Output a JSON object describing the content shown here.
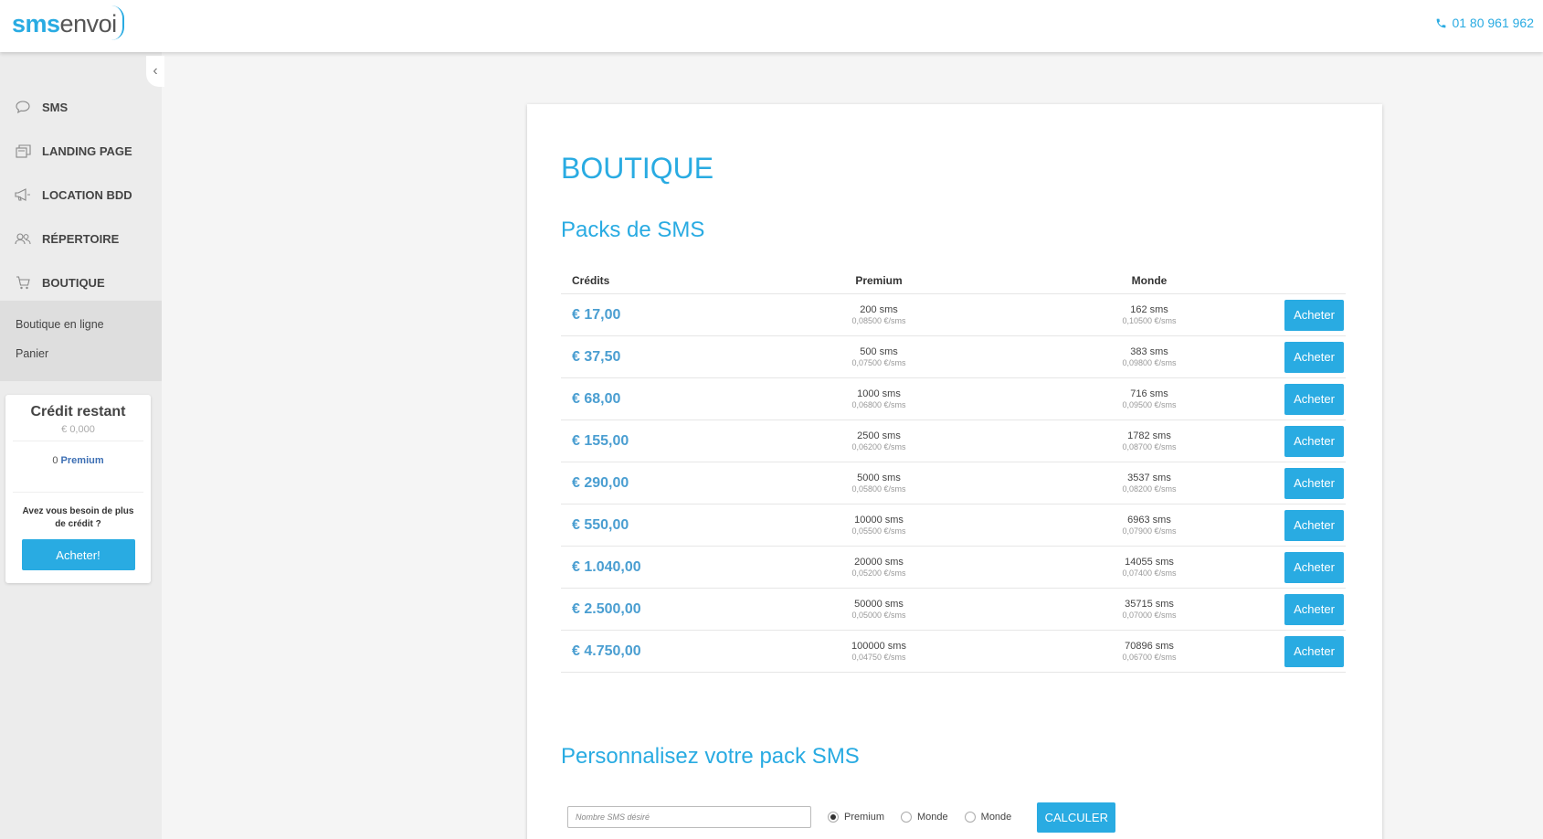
{
  "header": {
    "logo_part1": "sms",
    "logo_part2": "envoi",
    "phone": "01 80 961 962"
  },
  "sidebar": {
    "items": [
      {
        "label": "SMS",
        "icon": "chat-bubble-icon"
      },
      {
        "label": "LANDING PAGE",
        "icon": "layers-icon"
      },
      {
        "label": "LOCATION BDD",
        "icon": "megaphone-icon"
      },
      {
        "label": "RÉPERTOIRE",
        "icon": "contacts-icon"
      },
      {
        "label": "BOUTIQUE",
        "icon": "cart-icon"
      }
    ],
    "sub_items": [
      {
        "label": "Boutique en ligne"
      },
      {
        "label": "Panier"
      }
    ],
    "credit": {
      "title": "Crédit restant",
      "amount": "€ 0,000",
      "premium_count": "0",
      "premium_label": "Premium",
      "need_more": "Avez vous besoin de plus de crédit ?",
      "buy_label": "Acheter!"
    }
  },
  "main": {
    "title": "BOUTIQUE",
    "packs_title": "Packs de SMS",
    "columns": {
      "credits": "Crédits",
      "premium": "Premium",
      "monde": "Monde"
    },
    "rows": [
      {
        "price": "€ 17,00",
        "premium_qty": "200 sms",
        "premium_rate": "0,08500 €/sms",
        "monde_qty": "162 sms",
        "monde_rate": "0,10500 €/sms",
        "button": "Acheter"
      },
      {
        "price": "€ 37,50",
        "premium_qty": "500 sms",
        "premium_rate": "0,07500 €/sms",
        "monde_qty": "383 sms",
        "monde_rate": "0,09800 €/sms",
        "button": "Acheter"
      },
      {
        "price": "€ 68,00",
        "premium_qty": "1000 sms",
        "premium_rate": "0,06800 €/sms",
        "monde_qty": "716 sms",
        "monde_rate": "0,09500 €/sms",
        "button": "Acheter"
      },
      {
        "price": "€ 155,00",
        "premium_qty": "2500 sms",
        "premium_rate": "0,06200 €/sms",
        "monde_qty": "1782 sms",
        "monde_rate": "0,08700 €/sms",
        "button": "Acheter"
      },
      {
        "price": "€ 290,00",
        "premium_qty": "5000 sms",
        "premium_rate": "0,05800 €/sms",
        "monde_qty": "3537 sms",
        "monde_rate": "0,08200 €/sms",
        "button": "Acheter"
      },
      {
        "price": "€ 550,00",
        "premium_qty": "10000 sms",
        "premium_rate": "0,05500 €/sms",
        "monde_qty": "6963 sms",
        "monde_rate": "0,07900 €/sms",
        "button": "Acheter"
      },
      {
        "price": "€ 1.040,00",
        "premium_qty": "20000 sms",
        "premium_rate": "0,05200 €/sms",
        "monde_qty": "14055 sms",
        "monde_rate": "0,07400 €/sms",
        "button": "Acheter"
      },
      {
        "price": "€ 2.500,00",
        "premium_qty": "50000 sms",
        "premium_rate": "0,05000 €/sms",
        "monde_qty": "35715 sms",
        "monde_rate": "0,07000 €/sms",
        "button": "Acheter"
      },
      {
        "price": "€ 4.750,00",
        "premium_qty": "100000 sms",
        "premium_rate": "0,04750 €/sms",
        "monde_qty": "70896 sms",
        "monde_rate": "0,06700 €/sms",
        "button": "Acheter"
      }
    ],
    "custom_title": "Personnalisez votre pack SMS",
    "custom": {
      "placeholder": "Nombre SMS désiré",
      "options": [
        {
          "label": "Premium",
          "selected": true
        },
        {
          "label": "Monde",
          "selected": false
        },
        {
          "label": "Monde",
          "selected": false
        }
      ],
      "button": "CALCULER"
    }
  },
  "colors": {
    "accent": "#29abe2",
    "price": "#4a9ed1",
    "sidebar_bg": "#ececec"
  }
}
